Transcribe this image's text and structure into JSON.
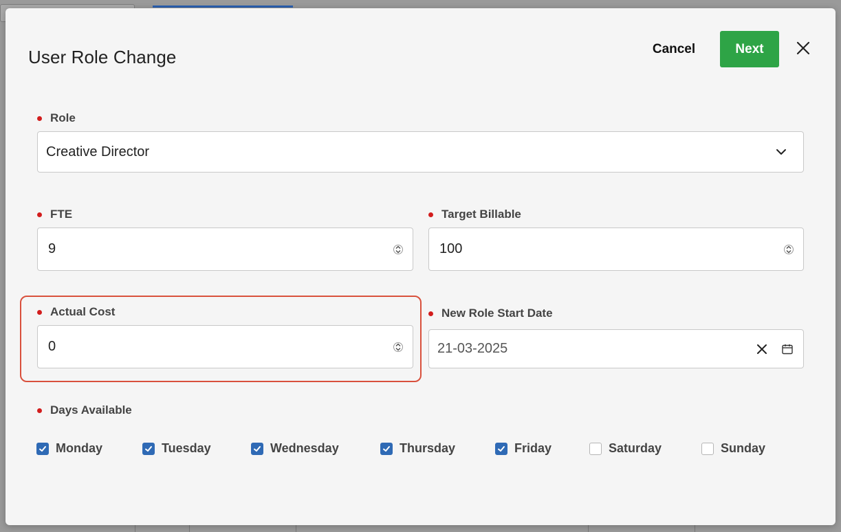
{
  "modal": {
    "title": "User Role Change",
    "cancel_label": "Cancel",
    "next_label": "Next",
    "accent_color": "#2ea446"
  },
  "fields": {
    "role": {
      "label": "Role",
      "value": "Creative Director"
    },
    "fte": {
      "label": "FTE",
      "value": "9"
    },
    "target_billable": {
      "label": "Target Billable",
      "value": "100"
    },
    "actual_cost": {
      "label": "Actual Cost",
      "value": "0"
    },
    "start_date": {
      "label": "New Role Start Date",
      "value": "21-03-2025"
    }
  },
  "days": {
    "label": "Days Available",
    "items": [
      {
        "name": "Monday",
        "checked": true
      },
      {
        "name": "Tuesday",
        "checked": true
      },
      {
        "name": "Wednesday",
        "checked": true
      },
      {
        "name": "Thursday",
        "checked": true
      },
      {
        "name": "Friday",
        "checked": true
      },
      {
        "name": "Saturday",
        "checked": false
      },
      {
        "name": "Sunday",
        "checked": false
      }
    ]
  },
  "colors": {
    "required": "#d21d1d",
    "checkbox": "#2f6ab5",
    "highlight": "#d9503c"
  }
}
